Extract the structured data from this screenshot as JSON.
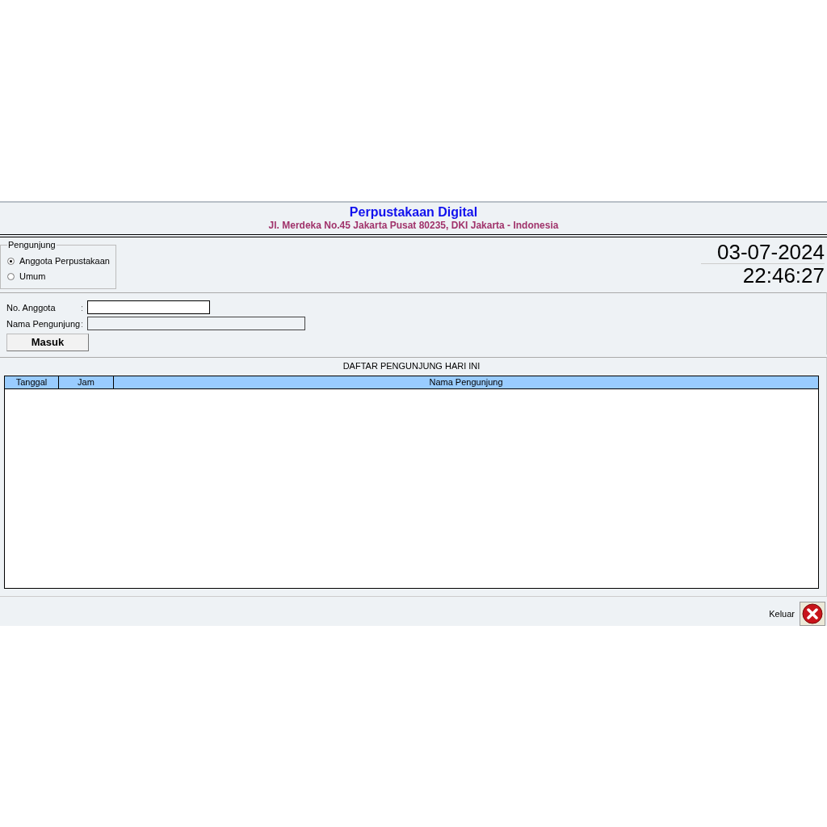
{
  "header": {
    "title": "Perpustakaan Digital",
    "subtitle": "Jl. Merdeka No.45 Jakarta Pusat 80235, DKI Jakarta - Indonesia"
  },
  "visitor_group": {
    "legend": "Pengunjung",
    "options": [
      {
        "label": "Anggota Perpustakaan",
        "selected": true
      },
      {
        "label": "Umum",
        "selected": false
      }
    ]
  },
  "clock": {
    "date": "03-07-2024",
    "time": "22:46:27"
  },
  "form": {
    "fields": [
      {
        "label": "No. Anggota",
        "separator": ":",
        "disabled": false
      },
      {
        "label": "Nama Pengunjung",
        "separator": ":",
        "disabled": true
      }
    ],
    "button": "Masuk"
  },
  "table": {
    "title": "DAFTAR PENGUNJUNG HARI INI",
    "columns": [
      "Tanggal",
      "Jam",
      "Nama Pengunjung"
    ]
  },
  "footer": {
    "exit_label": "Keluar"
  }
}
